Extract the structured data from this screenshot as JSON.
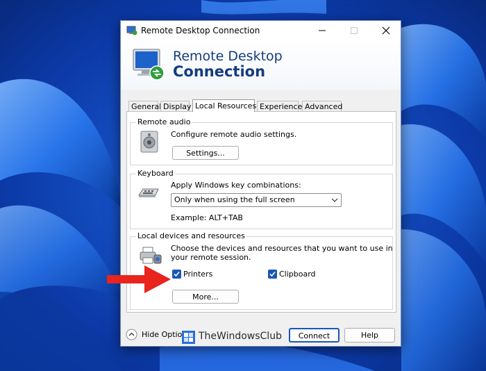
{
  "window": {
    "title": "Remote Desktop Connection"
  },
  "banner": {
    "line1": "Remote Desktop",
    "line2": "Connection"
  },
  "tabs": [
    {
      "label": "General"
    },
    {
      "label": "Display"
    },
    {
      "label": "Local Resources",
      "active": true
    },
    {
      "label": "Experience"
    },
    {
      "label": "Advanced"
    }
  ],
  "remote_audio": {
    "title": "Remote audio",
    "description": "Configure remote audio settings.",
    "settings_button": "Settings..."
  },
  "keyboard": {
    "title": "Keyboard",
    "description": "Apply Windows key combinations:",
    "selected": "Only when using the full screen",
    "example": "Example: ALT+TAB"
  },
  "local_devices": {
    "title": "Local devices and resources",
    "description_line1": "Choose the devices and resources that you want to use in",
    "description_line2": "your remote session.",
    "printers_label": "Printers",
    "printers_checked": true,
    "clipboard_label": "Clipboard",
    "clipboard_checked": true,
    "more_button": "More..."
  },
  "footer": {
    "hide_options": "Hide Options",
    "connect": "Connect",
    "help": "Help"
  },
  "watermark": {
    "text": "TheWindowsClub"
  },
  "colors": {
    "accent": "#1a56b8",
    "banner_text": "#143c7e",
    "arrow": "#e8241c"
  }
}
